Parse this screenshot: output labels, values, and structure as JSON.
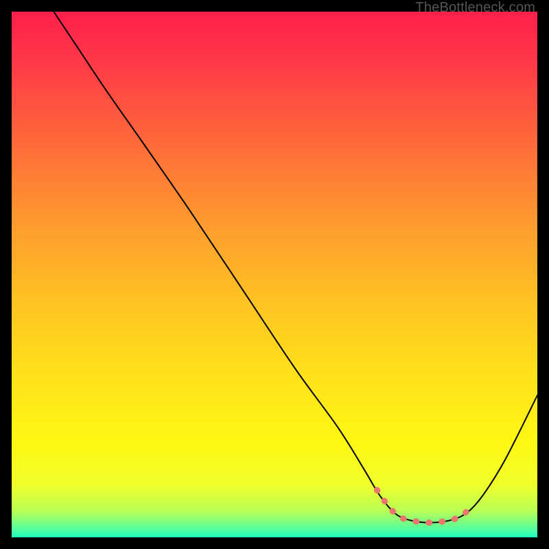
{
  "watermark": "TheBottleneck.com",
  "gradient_stops": [
    {
      "offset": 0.0,
      "color": "#ff1f4b"
    },
    {
      "offset": 0.1,
      "color": "#ff3a47"
    },
    {
      "offset": 0.25,
      "color": "#ff6a3a"
    },
    {
      "offset": 0.4,
      "color": "#ff9a2f"
    },
    {
      "offset": 0.55,
      "color": "#ffc223"
    },
    {
      "offset": 0.7,
      "color": "#ffe31a"
    },
    {
      "offset": 0.82,
      "color": "#fff814"
    },
    {
      "offset": 0.9,
      "color": "#f0ff2a"
    },
    {
      "offset": 0.95,
      "color": "#b8ff55"
    },
    {
      "offset": 0.975,
      "color": "#70ff88"
    },
    {
      "offset": 1.0,
      "color": "#1fffc0"
    }
  ],
  "chart_data": {
    "type": "line",
    "title": "",
    "xlabel": "",
    "ylabel": "",
    "xlim": [
      0,
      100
    ],
    "ylim": [
      0,
      100
    ],
    "series": [
      {
        "name": "bottleneck-curve",
        "points": [
          {
            "x": 8,
            "y": 100
          },
          {
            "x": 12,
            "y": 94
          },
          {
            "x": 18,
            "y": 85
          },
          {
            "x": 25,
            "y": 75
          },
          {
            "x": 34,
            "y": 62
          },
          {
            "x": 44,
            "y": 47
          },
          {
            "x": 54,
            "y": 32
          },
          {
            "x": 62,
            "y": 21
          },
          {
            "x": 67,
            "y": 13
          },
          {
            "x": 70,
            "y": 8
          },
          {
            "x": 73,
            "y": 4.5
          },
          {
            "x": 76,
            "y": 3.2
          },
          {
            "x": 80,
            "y": 2.8
          },
          {
            "x": 84,
            "y": 3.4
          },
          {
            "x": 87,
            "y": 5.0
          },
          {
            "x": 90,
            "y": 8.5
          },
          {
            "x": 94,
            "y": 15
          },
          {
            "x": 100,
            "y": 27
          }
        ]
      },
      {
        "name": "optimal-band",
        "stroke": "#e9766f",
        "stroke_width": 9,
        "dash": "1 18",
        "points": [
          {
            "x": 69.5,
            "y": 9.0
          },
          {
            "x": 72,
            "y": 5.5
          },
          {
            "x": 74,
            "y": 3.8
          },
          {
            "x": 76,
            "y": 3.2
          },
          {
            "x": 78,
            "y": 2.9
          },
          {
            "x": 80,
            "y": 2.8
          },
          {
            "x": 82,
            "y": 3.0
          },
          {
            "x": 84,
            "y": 3.4
          },
          {
            "x": 86,
            "y": 4.4
          },
          {
            "x": 88,
            "y": 6.5
          }
        ]
      }
    ]
  }
}
